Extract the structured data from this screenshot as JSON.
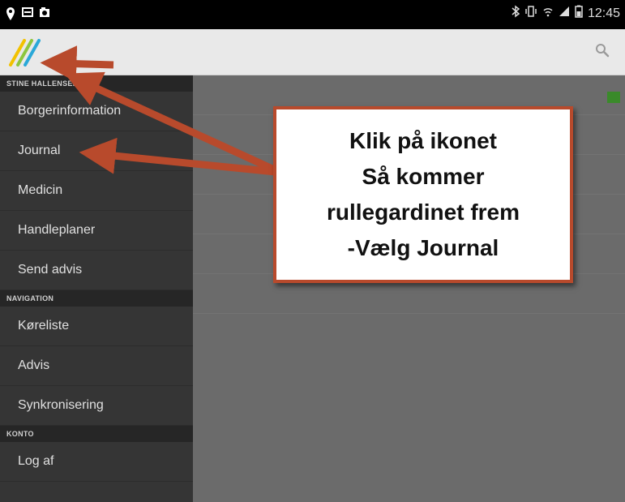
{
  "status_bar": {
    "time": "12:45",
    "left_icons": [
      "location-icon",
      "message-icon",
      "image-icon"
    ],
    "right_icons": [
      "bluetooth-icon",
      "vibrate-icon",
      "wifi-icon",
      "signal-icon",
      "battery-icon"
    ]
  },
  "app_bar": {
    "icons": [
      "app-logo-icon",
      "search-icon"
    ]
  },
  "drawer": {
    "sections": [
      {
        "header": "STINE HALLENSEN",
        "items": [
          "Borgerinformation",
          "Journal",
          "Medicin",
          "Handleplaner",
          "Send advis"
        ]
      },
      {
        "header": "NAVIGATION",
        "items": [
          "Køreliste",
          "Advis",
          "Synkronisering"
        ]
      },
      {
        "header": "KONTO",
        "items": [
          "Log af"
        ]
      }
    ]
  },
  "callout": {
    "lines": [
      "Klik på ikonet",
      "Så kommer",
      "rullegardinet frem",
      "-Vælg Journal"
    ]
  },
  "colors": {
    "status_bar": "#000000",
    "app_bar": "#e9e9e9",
    "drawer": "#353535",
    "drawer_section": "#262626",
    "content": "#6b6b6b",
    "arrow": "#b84a2c",
    "callout_border": "#b84a2c"
  }
}
